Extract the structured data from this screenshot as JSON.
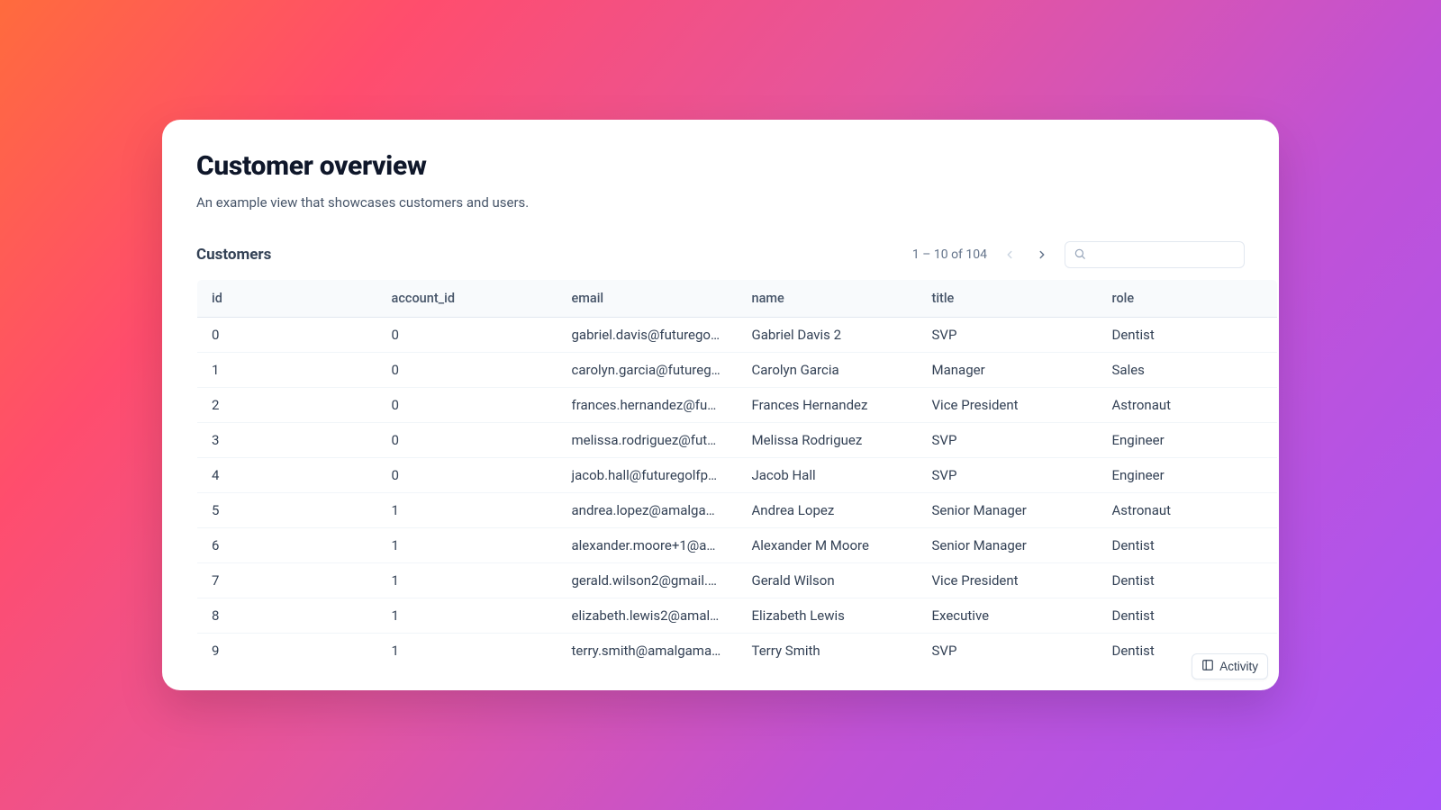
{
  "page": {
    "title": "Customer overview",
    "subtitle": "An example view that showcases customers and users."
  },
  "table": {
    "title": "Customers",
    "pagination_label": "1 – 10 of 104",
    "columns": [
      "id",
      "account_id",
      "email",
      "name",
      "title",
      "role"
    ],
    "rows": [
      {
        "id": "0",
        "account_id": "0",
        "email": "gabriel.davis@futurego…",
        "name": "Gabriel Davis 2",
        "title": "SVP",
        "role": "Dentist"
      },
      {
        "id": "1",
        "account_id": "0",
        "email": "carolyn.garcia@futureg…",
        "name": "Carolyn Garcia",
        "title": "Manager",
        "role": "Sales"
      },
      {
        "id": "2",
        "account_id": "0",
        "email": "frances.hernandez@fu…",
        "name": "Frances Hernandez",
        "title": "Vice President",
        "role": "Astronaut"
      },
      {
        "id": "3",
        "account_id": "0",
        "email": "melissa.rodriguez@fut…",
        "name": "Melissa Rodriguez",
        "title": "SVP",
        "role": "Engineer"
      },
      {
        "id": "4",
        "account_id": "0",
        "email": "jacob.hall@futuregolfp…",
        "name": "Jacob Hall",
        "title": "SVP",
        "role": "Engineer"
      },
      {
        "id": "5",
        "account_id": "1",
        "email": "andrea.lopez@amalga…",
        "name": "Andrea Lopez",
        "title": "Senior Manager",
        "role": "Astronaut"
      },
      {
        "id": "6",
        "account_id": "1",
        "email": "alexander.moore+1@a…",
        "name": "Alexander M Moore",
        "title": "Senior Manager",
        "role": "Dentist"
      },
      {
        "id": "7",
        "account_id": "1",
        "email": "gerald.wilson2@gmail.…",
        "name": "Gerald Wilson",
        "title": "Vice President",
        "role": "Dentist"
      },
      {
        "id": "8",
        "account_id": "1",
        "email": "elizabeth.lewis2@amal…",
        "name": "Elizabeth Lewis",
        "title": "Executive",
        "role": "Dentist"
      },
      {
        "id": "9",
        "account_id": "1",
        "email": "terry.smith@amalgama…",
        "name": "Terry Smith",
        "title": "SVP",
        "role": "Dentist"
      }
    ]
  },
  "activity": {
    "label": "Activity"
  }
}
